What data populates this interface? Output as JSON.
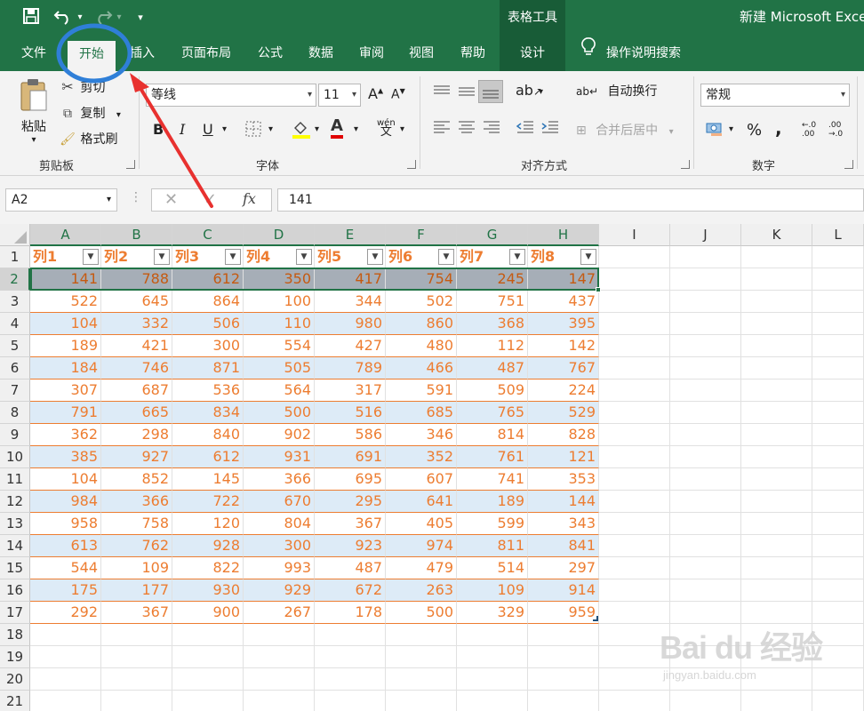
{
  "titlebar": {
    "tool_context": "表格工具",
    "app_title": "新建 Microsoft Excel",
    "qa_more": "▾"
  },
  "tabs": [
    {
      "label": "文件"
    },
    {
      "label": "开始"
    },
    {
      "label": "插入"
    },
    {
      "label": "页面布局"
    },
    {
      "label": "公式"
    },
    {
      "label": "数据"
    },
    {
      "label": "审阅"
    },
    {
      "label": "视图"
    },
    {
      "label": "帮助"
    },
    {
      "label": "设计"
    }
  ],
  "search": {
    "label": "操作说明搜索"
  },
  "ribbon": {
    "clipboard": {
      "paste": "粘贴",
      "cut": "剪切",
      "copy": "复制",
      "format_painter": "格式刷",
      "group": "剪贴板"
    },
    "font": {
      "name": "等线",
      "size": "11",
      "bold": "B",
      "italic": "I",
      "underline": "U",
      "phonetic": "wén",
      "group": "字体"
    },
    "alignment": {
      "wrap": "自动换行",
      "merge": "合并后居中",
      "group": "对齐方式"
    },
    "number": {
      "format": "常规",
      "percent": "%",
      "comma": ",",
      "inc_decimal": "←.0 .00",
      "dec_decimal": ".00 →.0",
      "group": "数字"
    }
  },
  "formula_bar": {
    "name_box": "A2",
    "fx": "fx",
    "value": "141"
  },
  "columns": [
    "A",
    "B",
    "C",
    "D",
    "E",
    "F",
    "G",
    "H",
    "I",
    "J",
    "K",
    "L"
  ],
  "rows": [
    "1",
    "2",
    "3",
    "4",
    "5",
    "6",
    "7",
    "8",
    "9",
    "10",
    "11",
    "12",
    "13",
    "14",
    "15",
    "16",
    "17",
    "18",
    "19",
    "20",
    "21"
  ],
  "table": {
    "headers": [
      "列1",
      "列2",
      "列3",
      "列4",
      "列5",
      "列6",
      "列7",
      "列8"
    ],
    "rows": [
      [
        "141",
        "788",
        "612",
        "350",
        "417",
        "754",
        "245",
        "147"
      ],
      [
        "522",
        "645",
        "864",
        "100",
        "344",
        "502",
        "751",
        "437"
      ],
      [
        "104",
        "332",
        "506",
        "110",
        "980",
        "860",
        "368",
        "395"
      ],
      [
        "189",
        "421",
        "300",
        "554",
        "427",
        "480",
        "112",
        "142"
      ],
      [
        "184",
        "746",
        "871",
        "505",
        "789",
        "466",
        "487",
        "767"
      ],
      [
        "307",
        "687",
        "536",
        "564",
        "317",
        "591",
        "509",
        "224"
      ],
      [
        "791",
        "665",
        "834",
        "500",
        "516",
        "685",
        "765",
        "529"
      ],
      [
        "362",
        "298",
        "840",
        "902",
        "586",
        "346",
        "814",
        "828"
      ],
      [
        "385",
        "927",
        "612",
        "931",
        "691",
        "352",
        "761",
        "121"
      ],
      [
        "104",
        "852",
        "145",
        "366",
        "695",
        "607",
        "741",
        "353"
      ],
      [
        "984",
        "366",
        "722",
        "670",
        "295",
        "641",
        "189",
        "144"
      ],
      [
        "958",
        "758",
        "120",
        "804",
        "367",
        "405",
        "599",
        "343"
      ],
      [
        "613",
        "762",
        "928",
        "300",
        "923",
        "974",
        "811",
        "841"
      ],
      [
        "544",
        "109",
        "822",
        "993",
        "487",
        "479",
        "514",
        "297"
      ],
      [
        "175",
        "177",
        "930",
        "929",
        "672",
        "263",
        "109",
        "914"
      ],
      [
        "292",
        "367",
        "900",
        "267",
        "178",
        "500",
        "329",
        "959"
      ]
    ]
  },
  "watermark": {
    "main": "Bai du 经验",
    "sub": "jingyan.baidu.com"
  },
  "colors": {
    "excel_green": "#217346",
    "dark_green": "#185c37",
    "accent_orange": "#ed7d31",
    "band_blue": "#ddebf7",
    "annotation_blue": "#2f7fd8",
    "annotation_red": "#e8312f"
  }
}
